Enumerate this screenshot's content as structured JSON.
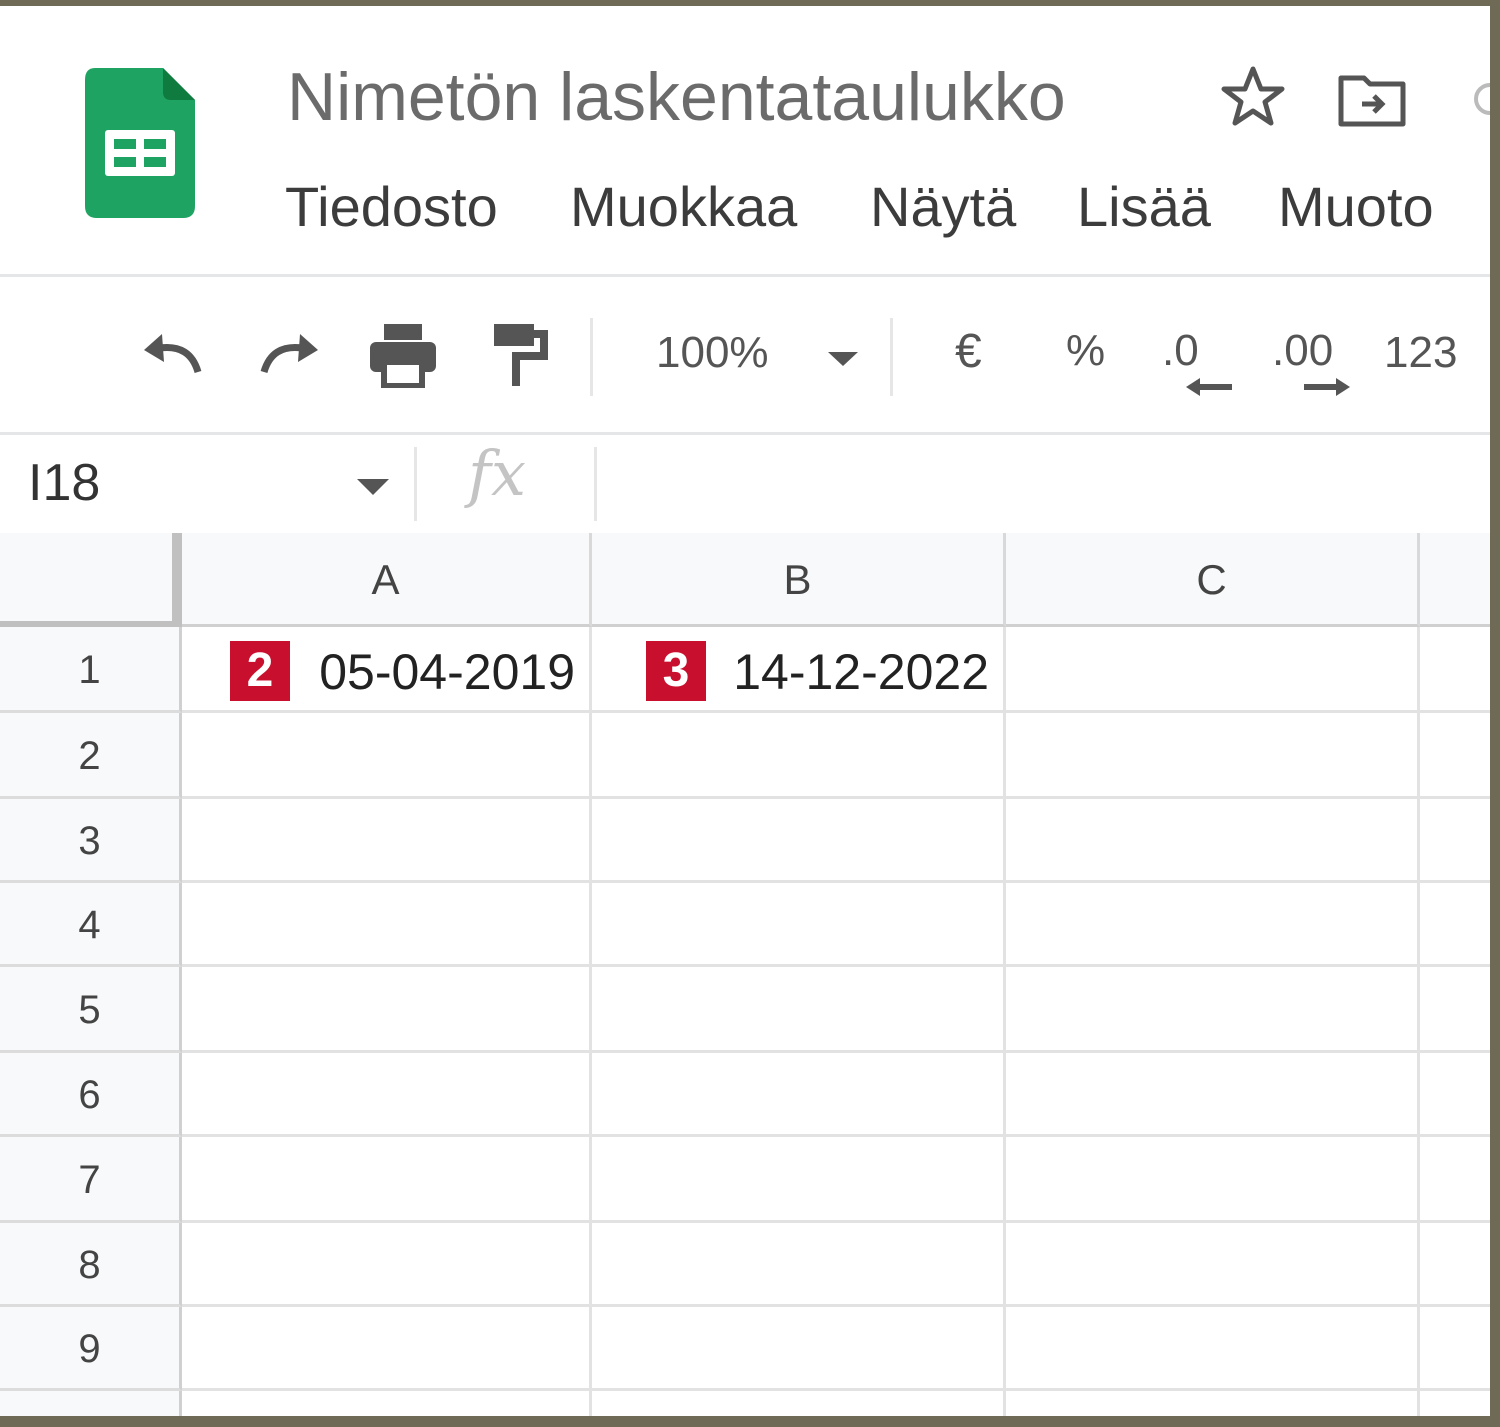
{
  "app": {
    "title": "Nimetön laskentataulukko",
    "brand_color": "#188038"
  },
  "menu": [
    "Tiedosto",
    "Muokkaa",
    "Näytä",
    "Lisää",
    "Muoto"
  ],
  "toolbar": {
    "zoom": "100%",
    "currency": "€",
    "percent": "%",
    "decrease_decimals": ".0",
    "increase_decimals": ".00",
    "more_formats": "123"
  },
  "formula_bar": {
    "name_box": "I18",
    "fx": "fx",
    "formula": ""
  },
  "sheet": {
    "columns": [
      "A",
      "B",
      "C"
    ],
    "rows": [
      "1",
      "2",
      "3",
      "4",
      "5",
      "6",
      "7",
      "8",
      "9"
    ],
    "cells": {
      "A1": "05-04-2019",
      "B1": "14-12-2022"
    }
  },
  "markers": {
    "a1": "2",
    "b1": "3",
    "color": "#c8102e"
  }
}
